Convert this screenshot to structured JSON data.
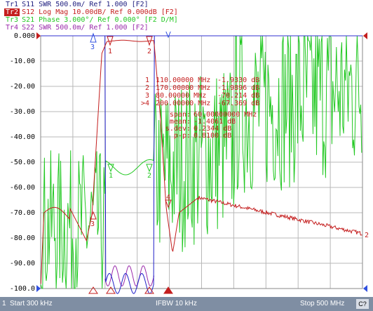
{
  "colors": {
    "tr1": "#202080",
    "tr2": "#c41e1e",
    "tr3": "#22c822",
    "tr4": "#9a2aaa",
    "grid": "#b8b8b8",
    "ref": "#3030d0",
    "stimulus": "#3050e0",
    "status_bar": "#7f8ea3"
  },
  "traces": [
    {
      "tag": "Tr1",
      "text": "S11  SWR 500.0m/ Ref 1.000 [F2]"
    },
    {
      "tag": "Tr2",
      "text": "S12  Log Mag 10.00dB/ Ref 0.000dB [F2]"
    },
    {
      "tag": "Tr3",
      "text": "S21  Phase 3.000°/ Ref 0.000° [F2 D/M]"
    },
    {
      "tag": "Tr4",
      "text": "S22  SWR 500.0m/ Ref 1.000 [F2]"
    }
  ],
  "y_axis": {
    "min": -100,
    "max": 0,
    "tick_labels": [
      "0.000",
      "-10.00",
      "-20.00",
      "-30.00",
      "-40.00",
      "-50.00",
      "-60.00",
      "-70.00",
      "-80.00",
      "-90.00",
      "-100.0"
    ]
  },
  "markers": [
    {
      "num": "1",
      "freq": "110.00000 MHz",
      "value": "-1.9330 dB"
    },
    {
      "num": "2",
      "freq": "170.00000 MHz",
      "value": "-1.9896 dB"
    },
    {
      "num": "3",
      "freq": "80.00000 MHz",
      "value": "-70.214 dB"
    },
    {
      "num": ">4",
      "freq": "200.00000 MHz",
      "value": "-67.369 dB"
    }
  ],
  "stats": [
    {
      "label": "span:",
      "value": "60.00000000 MHz"
    },
    {
      "label": "mean:",
      "value": "-1.4061 dB"
    },
    {
      "label": "s.dev:",
      "value": "0.2344 dB"
    },
    {
      "label": "p-p:",
      "value": "0.8100 dB"
    }
  ],
  "plot_markers": {
    "m1": "1",
    "m2": "2",
    "m3": "3",
    "m4": "4"
  },
  "channel_end_label": "2",
  "status_bar": {
    "channel": "1",
    "start": "Start 300 kHz",
    "ifbw": "IFBW 10 kHz",
    "stop": "Stop 500 MHz",
    "cal": "C?"
  }
}
